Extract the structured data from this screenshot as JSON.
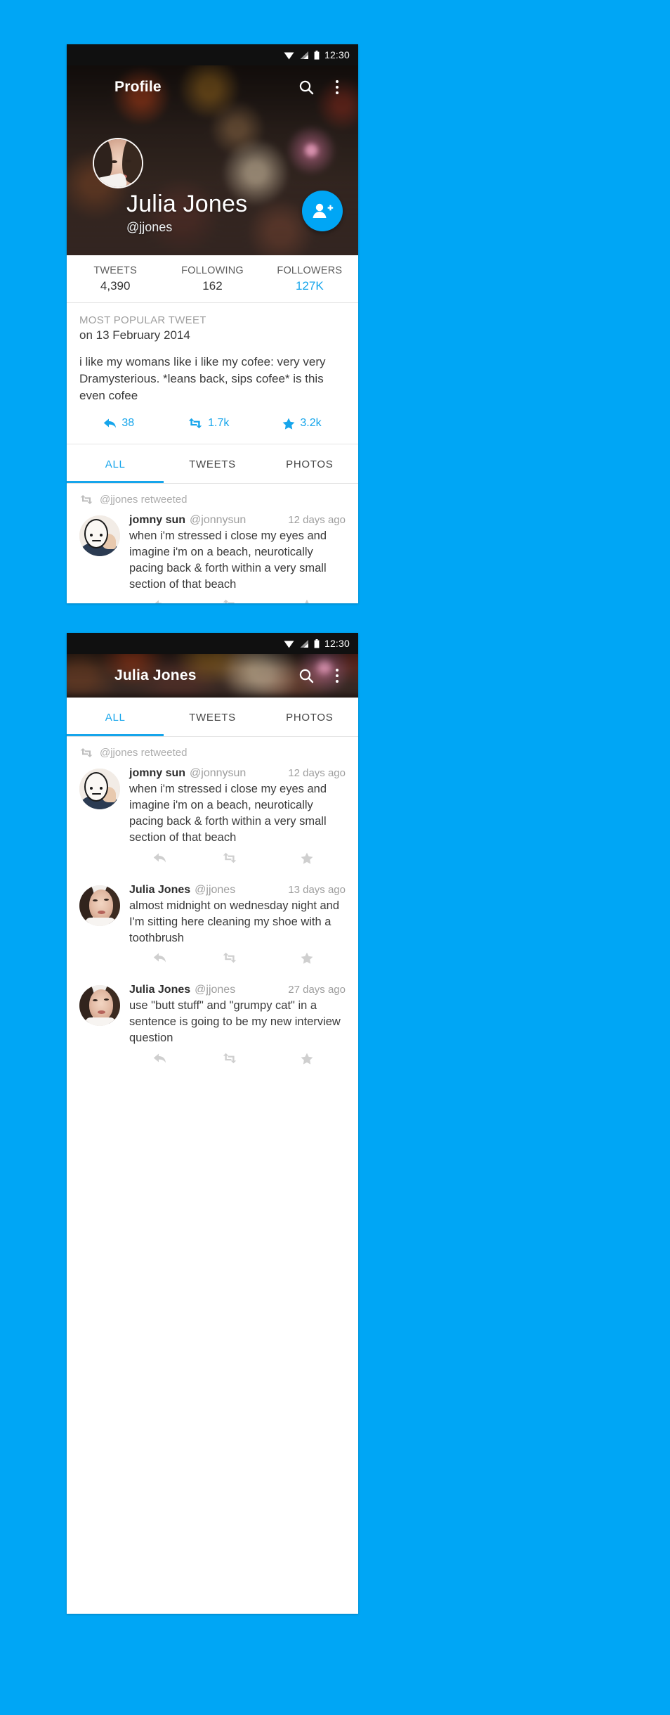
{
  "theme": {
    "background": "#00a6f5",
    "accent": "#16a5eb",
    "fab": "#00a6f5",
    "text_primary": "#3b3b3b",
    "text_muted": "#9e9e9e"
  },
  "statusbar": {
    "time": "12:30",
    "icons": [
      "wifi-icon",
      "signal-icon",
      "battery-icon"
    ]
  },
  "screen1": {
    "appbar": {
      "title": "Profile",
      "menu_icon": "hamburger-icon",
      "search_icon": "search-icon",
      "overflow_icon": "overflow-menu-icon"
    },
    "profile": {
      "name": "Julia Jones",
      "handle": "@jjones",
      "follow_button_icon": "add-person-icon"
    },
    "stats": [
      {
        "label": "TWEETS",
        "value": "4,390",
        "accent": false
      },
      {
        "label": "FOLLOWING",
        "value": "162",
        "accent": false
      },
      {
        "label": "FOLLOWERS",
        "value": "127K",
        "accent": true
      }
    ],
    "popular": {
      "kicker": "MOST POPULAR TWEET",
      "date": "on 13 February 2014",
      "body": "i like my womans like i like my cofee: very very Dramysterious. *leans back, sips cofee* is this even cofee",
      "actions": [
        {
          "icon": "reply-icon",
          "count": "38"
        },
        {
          "icon": "retweet-icon",
          "count": "1.7k"
        },
        {
          "icon": "star-icon",
          "count": "3.2k"
        }
      ]
    },
    "tabs": [
      {
        "label": "ALL",
        "active": true
      },
      {
        "label": "TWEETS",
        "active": false
      },
      {
        "label": "PHOTOS",
        "active": false
      }
    ],
    "feed": [
      {
        "retweet_note": "@jjones retweeted",
        "avatar": "jomny-sun-avatar",
        "name": "jomny sun",
        "handle": "@jonnysun",
        "time": "12 days ago",
        "text": "when i'm stressed i close my eyes and imagine i'm on a beach, neurotically pacing back & forth within a very small section of that beach",
        "actions": [
          "reply-icon",
          "retweet-icon",
          "star-icon"
        ]
      }
    ]
  },
  "screen2": {
    "appbar": {
      "title": "Julia Jones",
      "menu_icon": "hamburger-icon",
      "search_icon": "search-icon",
      "overflow_icon": "overflow-menu-icon"
    },
    "tabs": [
      {
        "label": "ALL",
        "active": true
      },
      {
        "label": "TWEETS",
        "active": false
      },
      {
        "label": "PHOTOS",
        "active": false
      }
    ],
    "feed": [
      {
        "retweet_note": "@jjones retweeted",
        "avatar": "jomny-sun-avatar",
        "name": "jomny sun",
        "handle": "@jonnysun",
        "time": "12 days ago",
        "text": "when i'm stressed i close my eyes and imagine i'm on a beach, neurotically pacing back & forth within a very small section of that beach",
        "actions": [
          "reply-icon",
          "retweet-icon",
          "star-icon"
        ]
      },
      {
        "retweet_note": "",
        "avatar": "julia-jones-avatar",
        "name": "Julia Jones",
        "handle": "@jjones",
        "time": "13 days ago",
        "text": "almost midnight on wednesday night and I'm sitting here cleaning my shoe with a toothbrush",
        "actions": [
          "reply-icon",
          "retweet-icon",
          "star-icon"
        ]
      },
      {
        "retweet_note": "",
        "avatar": "julia-jones-avatar",
        "name": "Julia Jones",
        "handle": "@jjones",
        "time": "27 days ago",
        "text": "use \"butt stuff\" and \"grumpy cat\" in a sentence is going to be my new interview question",
        "actions": [
          "reply-icon",
          "retweet-icon",
          "star-icon"
        ]
      }
    ]
  }
}
